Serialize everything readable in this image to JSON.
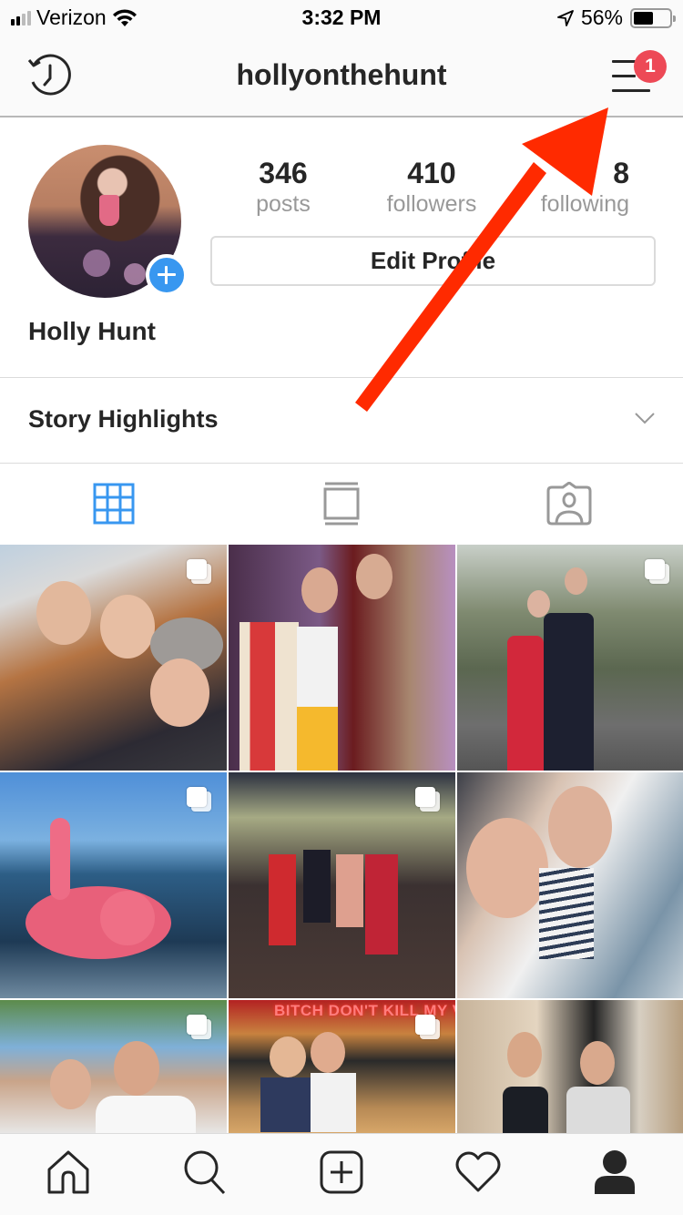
{
  "status_bar": {
    "carrier": "Verizon",
    "signal_bars": 2,
    "signal_total": 4,
    "time": "3:32 PM",
    "battery_percent": "56%",
    "battery_level": 0.56,
    "icons": [
      "signal-icon",
      "wifi-icon",
      "location-arrow-icon",
      "battery-icon"
    ]
  },
  "header": {
    "username": "hollyonthehunt",
    "left_icon": "history-icon",
    "right_icon": "hamburger-menu-icon",
    "notification_badge": "1",
    "badge_color": "#ed4956"
  },
  "profile": {
    "full_name": "Holly Hunt",
    "add_story_icon": "plus-icon",
    "accent_color": "#3897f0",
    "stats": [
      {
        "value": "346",
        "label": "posts"
      },
      {
        "value": "410",
        "label": "followers"
      },
      {
        "value": "8",
        "label": "following",
        "note": "partially obscured by arrow"
      }
    ],
    "edit_profile_label": "Edit Profile"
  },
  "story_highlights": {
    "label": "Story Highlights",
    "icon": "chevron-down-icon"
  },
  "tabs": [
    {
      "name": "grid",
      "icon": "grid-icon",
      "active": true
    },
    {
      "name": "feed",
      "icon": "list-view-icon",
      "active": false
    },
    {
      "name": "tagged",
      "icon": "tagged-photos-icon",
      "active": false
    }
  ],
  "posts": [
    {
      "description": "Three friends selfie outdoors",
      "multi_photo": true
    },
    {
      "description": "Bacon and egg costume with friend",
      "multi_photo": false
    },
    {
      "description": "Couple in formal wear on bridge by river",
      "multi_photo": true
    },
    {
      "description": "Pink flamingo float in the sea",
      "multi_photo": true
    },
    {
      "description": "Four women in dresses on a terrace",
      "multi_photo": true
    },
    {
      "description": "Couple selfie by the water",
      "multi_photo": false
    },
    {
      "description": "Couple at outdoor festival",
      "multi_photo": true
    },
    {
      "description": "Two friends under neon sign",
      "multi_photo": true,
      "sign_text": "BITCH DON'T KILL MY VIBE"
    },
    {
      "description": "Two friends laughing outside house",
      "multi_photo": false
    }
  ],
  "bottom_nav": [
    {
      "name": "home",
      "icon": "home-icon"
    },
    {
      "name": "search",
      "icon": "search-icon"
    },
    {
      "name": "new-post",
      "icon": "add-post-icon"
    },
    {
      "name": "activity",
      "icon": "heart-icon"
    },
    {
      "name": "profile",
      "icon": "profile-icon",
      "active": true
    }
  ],
  "annotation": {
    "type": "arrow",
    "color": "#ff2a00",
    "points_to": "hamburger-menu-icon"
  }
}
